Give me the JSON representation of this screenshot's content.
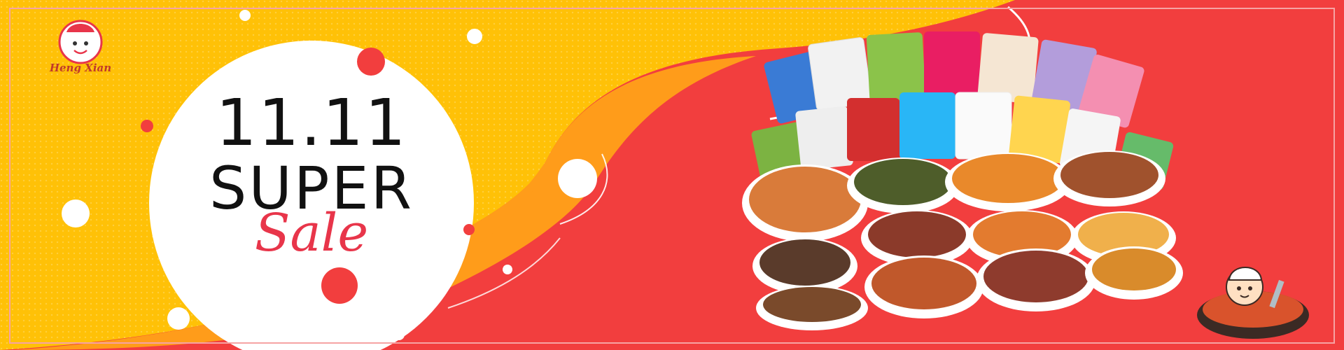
{
  "banner": {
    "logo_text": "Heng Xian",
    "headline": {
      "date": "11.11",
      "super": "SUPER",
      "sale": "Sale"
    },
    "colors": {
      "yellow": "#ffc107",
      "orange": "#ff9c1a",
      "red": "#f23e3e",
      "white": "#ffffff",
      "accent": "#e8354a"
    },
    "images": {
      "logo": "chef-mascot-logo",
      "products": "snack-packages-and-meat-dishes",
      "mascot": "cartoon-chef-hotpot-mascot"
    }
  }
}
